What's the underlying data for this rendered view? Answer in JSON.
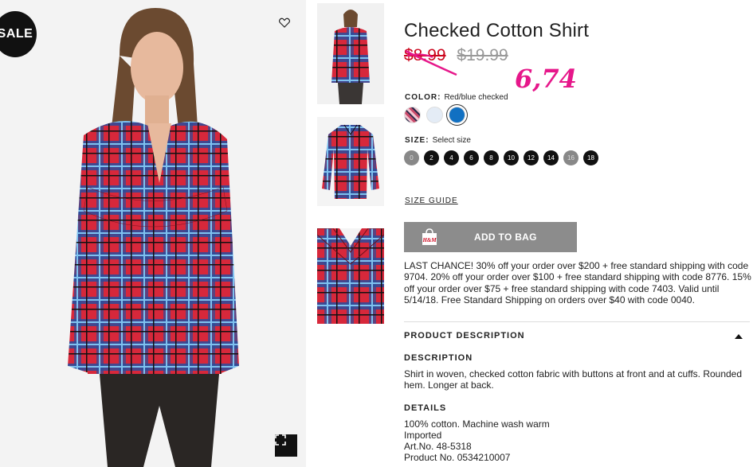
{
  "badge": {
    "sale": "SALE"
  },
  "product": {
    "title": "Checked Cotton Shirt",
    "price_sale": "$8.99",
    "price_original": "$19.99",
    "handwritten_price": "6,74"
  },
  "color": {
    "label": "COLOR:",
    "value": "Red/blue checked",
    "swatches": [
      {
        "name": "red-checked",
        "color": "#c94a6a"
      },
      {
        "name": "light-blue",
        "color": "#e4ecf6"
      },
      {
        "name": "blue",
        "color": "#1170c2"
      }
    ]
  },
  "size": {
    "label": "SIZE:",
    "value": "Select size",
    "options": [
      {
        "label": "0",
        "available": false
      },
      {
        "label": "2",
        "available": true
      },
      {
        "label": "4",
        "available": true
      },
      {
        "label": "6",
        "available": true
      },
      {
        "label": "8",
        "available": true
      },
      {
        "label": "10",
        "available": true
      },
      {
        "label": "12",
        "available": true
      },
      {
        "label": "14",
        "available": true
      },
      {
        "label": "16",
        "available": false
      },
      {
        "label": "18",
        "available": true
      }
    ]
  },
  "size_guide": "SIZE GUIDE",
  "add_to_bag": "ADD TO BAG",
  "bag_logo": "H&M",
  "promo": "LAST CHANCE! 30% off your order over $200 + free standard shipping with code 9704. 20% off your order over $100 + free standard shipping with code 8776. 15% off your order over $75 + free standard shipping with code 7403. Valid until 5/14/18. Free Standard Shipping on orders over $40 with code 0040.",
  "product_description": {
    "heading": "PRODUCT DESCRIPTION",
    "description_heading": "DESCRIPTION",
    "description": "Shirt in woven, checked cotton fabric with buttons at front and at cuffs. Rounded hem. Longer at back.",
    "details_heading": "DETAILS",
    "details": [
      "100% cotton. Machine wash warm",
      "Imported",
      "Art.No. 48-5318",
      "Product No. 0534210007"
    ]
  },
  "icons": {
    "favorite": "heart-icon",
    "fullscreen": "expand-icon",
    "collapse": "triangle-up-icon"
  },
  "colors": {
    "sale_red": "#cc071e",
    "handwritten": "#e6178a",
    "button_gray": "#8c8c8c"
  }
}
